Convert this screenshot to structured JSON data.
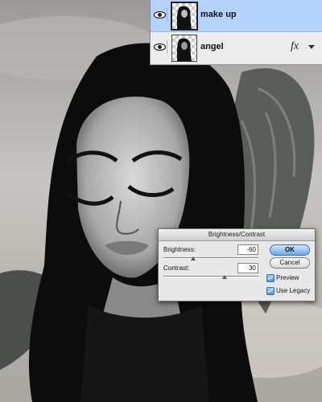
{
  "layers": [
    {
      "name": "make up",
      "selected": true,
      "fx": ""
    },
    {
      "name": "angel",
      "selected": false,
      "fx": "fx"
    }
  ],
  "dialog": {
    "title": "Brightness/Contrast",
    "brightness_label": "Brightness:",
    "brightness_value": "-60",
    "contrast_label": "Contrast:",
    "contrast_value": "30",
    "ok_label": "OK",
    "cancel_label": "Cancel",
    "preview_label": "Preview",
    "preview_checked": true,
    "legacy_label": "Use Legacy",
    "legacy_checked": true
  },
  "colors": {
    "selected_layer": "#b3d3fb",
    "accent": "#6ea6ec"
  }
}
